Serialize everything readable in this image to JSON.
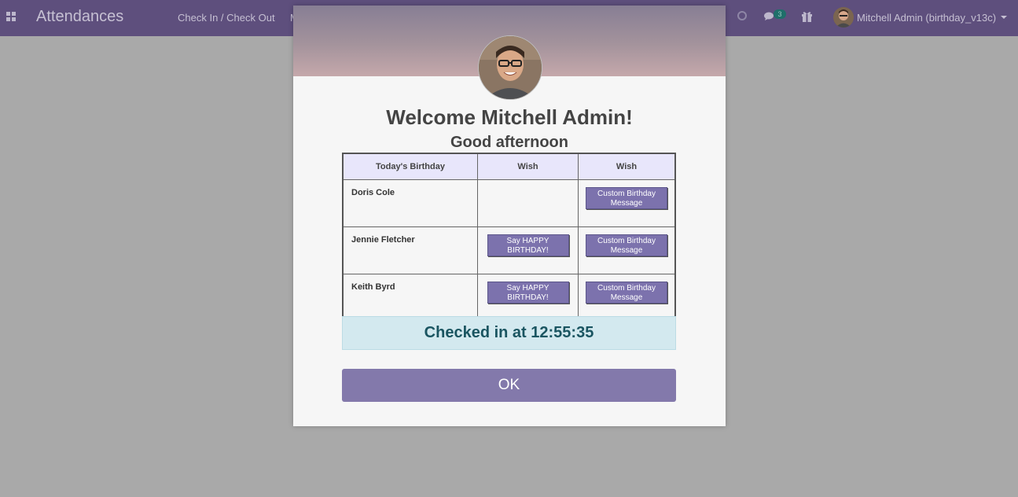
{
  "navbar": {
    "app_title": "Attendances",
    "menu": [
      "Check In / Check Out",
      "M"
    ],
    "chat_badge": "3",
    "user_name": "Mitchell Admin (birthday_v13c)",
    "icons": [
      "apps-icon",
      "clock-icon",
      "chat-icon",
      "gift-icon",
      "chevron-down-icon"
    ]
  },
  "modal": {
    "welcome": "Welcome Mitchell Admin!",
    "greeting": "Good afternoon",
    "table": {
      "headers": [
        "Today's Birthday",
        "Wish",
        "Wish"
      ],
      "rows": [
        {
          "name": "Doris Cole",
          "wish1": "",
          "wish2": "Custom Birthday Message"
        },
        {
          "name": "Jennie Fletcher",
          "wish1": "Say HAPPY BIRTHDAY!",
          "wish2": "Custom Birthday Message"
        },
        {
          "name": "Keith Byrd",
          "wish1": "Say HAPPY BIRTHDAY!",
          "wish2": "Custom Birthday Message"
        }
      ]
    },
    "checked_in": "Checked in at 12:55:35",
    "ok_label": "OK"
  },
  "colors": {
    "navbar": "#5e4f7d",
    "backdrop": "#a9a9a9",
    "button": "#7c72ad",
    "table_header": "#e8e6fb",
    "checked_bg": "#d3e9ef",
    "checked_text": "#1a5561"
  }
}
